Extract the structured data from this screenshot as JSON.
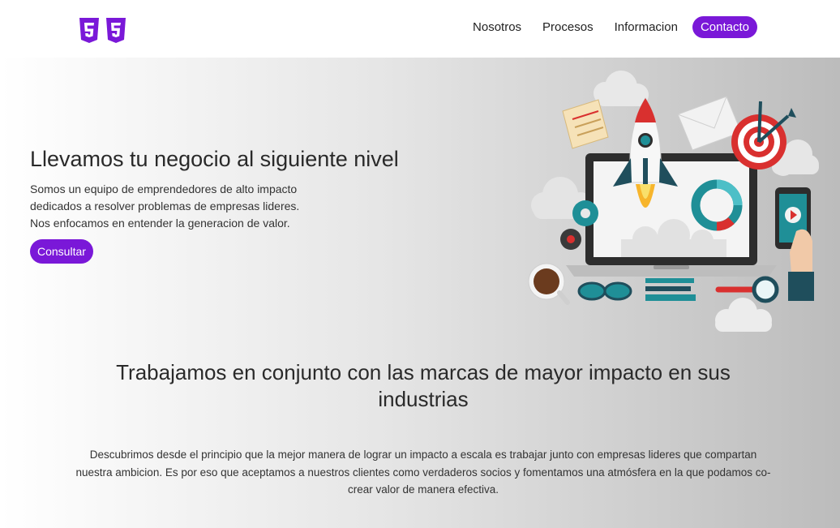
{
  "header": {
    "logo_icons": [
      "html5-icon",
      "css3-icon"
    ],
    "nav": [
      {
        "label": "Nosotros"
      },
      {
        "label": "Procesos"
      },
      {
        "label": "Informacion"
      },
      {
        "label": "Contacto"
      }
    ]
  },
  "hero": {
    "title": "Llevamos tu negocio al siguiente nivel",
    "desc_lines": [
      "Somos un equipo de emprendedores de alto impacto",
      "dedicados a resolver problemas de empresas lideres.",
      "Nos enfocamos en entender la generacion de valor."
    ],
    "button": "Consultar"
  },
  "section": {
    "title": "Trabajamos en conjunto con las marcas de mayor impacto en sus industrias",
    "text": "Descubrimos desde el principio que la mejor manera de lograr un impacto a escala es trabajar junto con empresas lideres que compartan nuestra ambicion. Es por eso que aceptamos a nuestros clientes como verdaderos socios y fomentamos una atmósfera en la que podamos co-crear valor de manera efectiva."
  },
  "colors": {
    "accent": "#7a18d8",
    "rocket_red": "#d9302f",
    "teal": "#1f8f97",
    "dark": "#2d2d2d"
  }
}
